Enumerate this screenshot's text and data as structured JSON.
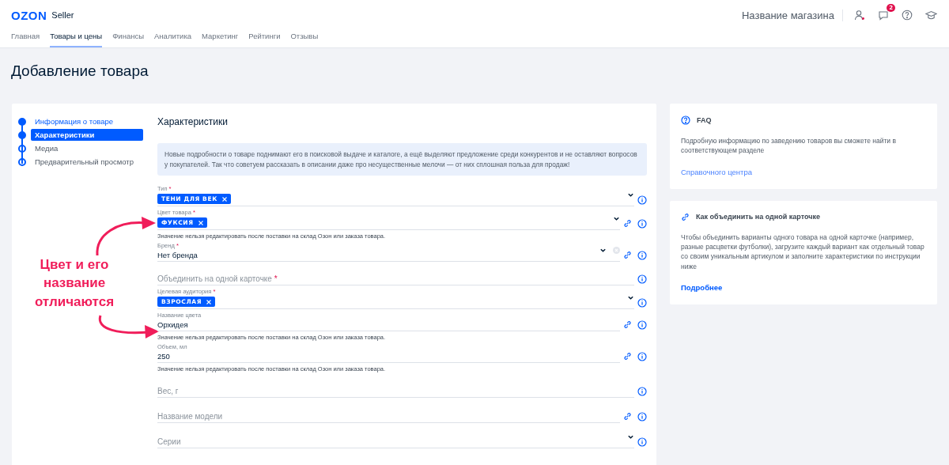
{
  "header": {
    "logo": "OZON",
    "logo_suffix": "Seller",
    "shop_name": "Название магазина",
    "notifications_badge": "2"
  },
  "nav": [
    {
      "label": "Главная",
      "selected": false
    },
    {
      "label": "Товары и цены",
      "selected": true
    },
    {
      "label": "Финансы",
      "selected": false
    },
    {
      "label": "Аналитика",
      "selected": false
    },
    {
      "label": "Маркетинг",
      "selected": false
    },
    {
      "label": "Рейтинги",
      "selected": false
    },
    {
      "label": "Отзывы",
      "selected": false
    }
  ],
  "page_title": "Добавление товара",
  "steps": [
    {
      "label": "Информация о товаре",
      "done": true,
      "selected": false
    },
    {
      "label": "Характеристики",
      "done": true,
      "selected": true
    },
    {
      "label": "Медиа",
      "done": false,
      "selected": false
    },
    {
      "label": "Предварительный просмотр",
      "done": false,
      "selected": false
    }
  ],
  "annotation": "Цвет и его название отличаются",
  "section_title": "Характеристики",
  "info_text": "Новые подробности о товаре поднимают его в поисковой выдаче и каталоге, а ещё выделяют предложение среди конкурентов и не оставляют вопросов у покупателей. Так что советуем рассказать в описании даже про несущественные мелочи — от них сплошная польза для продаж!",
  "fields": [
    {
      "kind": "tags",
      "label": "Тип",
      "required_mark": "*",
      "tags": [
        "ТЕНИ ДЛЯ ВЕК"
      ],
      "dropdown": true,
      "clearable": false,
      "linked": false
    },
    {
      "kind": "tags",
      "label": "Цвет товара",
      "required_mark": "*",
      "tags": [
        "ФУКСИЯ"
      ],
      "dropdown": true,
      "clearable": false,
      "linked": true,
      "note": "Значение нельзя редактировать после поставки на склад Озон или заказа товара."
    },
    {
      "kind": "select",
      "label": "Бренд",
      "required_mark": "*",
      "value": "Нет бренда",
      "dropdown": true,
      "clearable": true,
      "linked": true
    },
    {
      "kind": "empty",
      "placeholder": "Объединить на одной карточке",
      "required_mark": "*",
      "dropdown": false,
      "clearable": false,
      "linked": false
    },
    {
      "kind": "tags",
      "label": "Целевая аудитория",
      "required_mark": "*",
      "tags": [
        "ВЗРОСЛАЯ"
      ],
      "dropdown": true,
      "clearable": false,
      "linked": false
    },
    {
      "kind": "text",
      "label": "Название цвета",
      "value": "Орхидея",
      "dropdown": false,
      "clearable": false,
      "linked": true,
      "note": "Значение нельзя редактировать после поставки на склад Озон или заказа товара."
    },
    {
      "kind": "text",
      "label": "Объем, мл",
      "value": "250",
      "dropdown": false,
      "clearable": false,
      "linked": true,
      "note": "Значение нельзя редактировать после поставки на склад Озон или заказа товара."
    },
    {
      "kind": "empty",
      "placeholder": "Вес, г",
      "dropdown": false,
      "clearable": false,
      "linked": false
    },
    {
      "kind": "empty",
      "placeholder": "Название модели",
      "dropdown": false,
      "clearable": false,
      "linked": true
    },
    {
      "kind": "empty",
      "placeholder": "Серии",
      "dropdown": true,
      "clearable": false,
      "linked": false
    }
  ],
  "cards": [
    {
      "kind": "faq",
      "title": "FAQ",
      "text": "Подробную информацию по заведению товаров вы сможете найти в соответствующем разделе",
      "link": "Справочного центра"
    },
    {
      "kind": "link",
      "title": "Как объединить на одной карточке",
      "text": "Чтобы объединить варианты одного товара на одной карточке (например, разные расцветки футболки), загрузите каждый вариант как отдельный товар со своим уникальным артикулом и заполните характеристики по инструкции ниже",
      "link": "Подробнее"
    }
  ]
}
